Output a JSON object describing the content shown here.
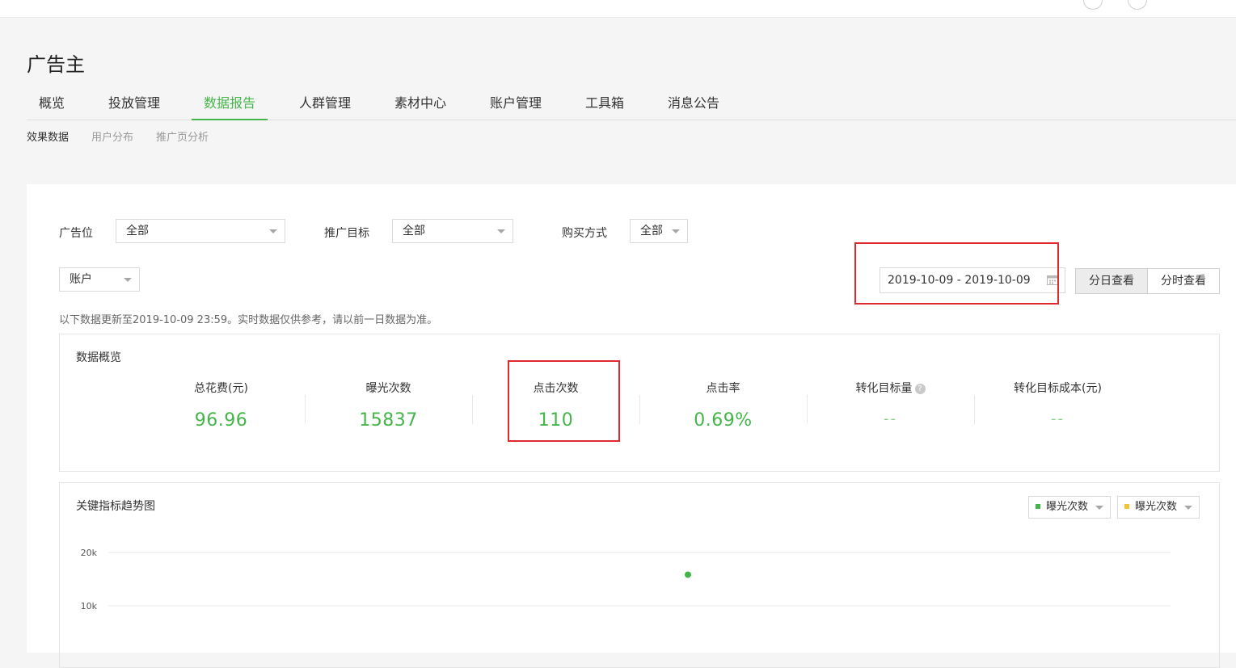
{
  "app": {
    "title": "广告主"
  },
  "main_tabs": [
    {
      "label": "概览"
    },
    {
      "label": "投放管理"
    },
    {
      "label": "数据报告",
      "active": true
    },
    {
      "label": "人群管理"
    },
    {
      "label": "素材中心"
    },
    {
      "label": "账户管理"
    },
    {
      "label": "工具箱"
    },
    {
      "label": "消息公告"
    }
  ],
  "sub_tabs": [
    {
      "label": "效果数据",
      "active": true
    },
    {
      "label": "用户分布"
    },
    {
      "label": "推广页分析"
    }
  ],
  "filters": {
    "ad_position": {
      "label": "广告位",
      "value": "全部"
    },
    "promo_goal": {
      "label": "推广目标",
      "value": "全部"
    },
    "purchase_method": {
      "label": "购买方式",
      "value": "全部"
    },
    "dimension": {
      "value": "账户"
    },
    "date_range": "2019-10-09 - 2019-10-09",
    "view_buttons": [
      {
        "label": "分日查看",
        "active": true
      },
      {
        "label": "分时查看"
      }
    ]
  },
  "notice": "以下数据更新至2019-10-09 23:59。实时数据仅供参考，请以前一日数据为准。",
  "overview": {
    "title": "数据概览",
    "metrics": [
      {
        "label": "总花费(元)",
        "value": "96.96"
      },
      {
        "label": "曝光次数",
        "value": "15837"
      },
      {
        "label": "点击次数",
        "value": "110"
      },
      {
        "label": "点击率",
        "value": "0.69%"
      },
      {
        "label": "转化目标量",
        "value": "--",
        "has_help_icon": true
      },
      {
        "label": "转化目标成本(元)",
        "value": "--"
      }
    ]
  },
  "trend": {
    "title": "关键指标趋势图",
    "legend_selects": [
      {
        "label": "曝光次数",
        "color": "#44b549"
      },
      {
        "label": "曝光次数",
        "color": "#f5c333"
      }
    ]
  },
  "chart_data": {
    "type": "scatter",
    "y_ticks": [
      "20k",
      "10k"
    ],
    "y_tick_values": [
      20000,
      10000
    ],
    "series": [
      {
        "values": [
          15837
        ],
        "color": "#44b549"
      }
    ]
  },
  "colors": {
    "accent": "#44b549",
    "highlight_box": "#e0282f"
  },
  "icons": {
    "date_input": "calendar-icon",
    "select": "chevron-down-icon",
    "help": "help-icon"
  }
}
